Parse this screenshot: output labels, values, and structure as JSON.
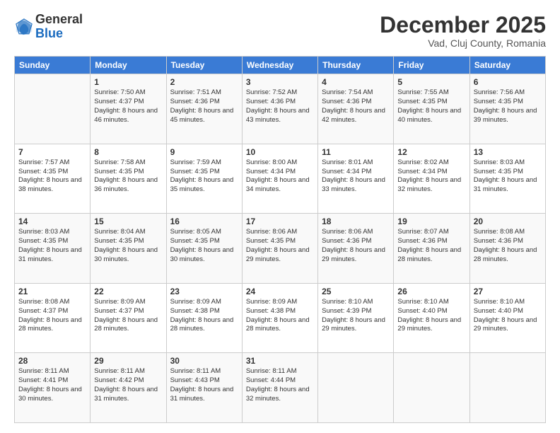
{
  "header": {
    "logo_general": "General",
    "logo_blue": "Blue",
    "month_title": "December 2025",
    "subtitle": "Vad, Cluj County, Romania"
  },
  "days_of_week": [
    "Sunday",
    "Monday",
    "Tuesday",
    "Wednesday",
    "Thursday",
    "Friday",
    "Saturday"
  ],
  "weeks": [
    [
      {
        "day": "",
        "sunrise": "",
        "sunset": "",
        "daylight": ""
      },
      {
        "day": "1",
        "sunrise": "Sunrise: 7:50 AM",
        "sunset": "Sunset: 4:37 PM",
        "daylight": "Daylight: 8 hours and 46 minutes."
      },
      {
        "day": "2",
        "sunrise": "Sunrise: 7:51 AM",
        "sunset": "Sunset: 4:36 PM",
        "daylight": "Daylight: 8 hours and 45 minutes."
      },
      {
        "day": "3",
        "sunrise": "Sunrise: 7:52 AM",
        "sunset": "Sunset: 4:36 PM",
        "daylight": "Daylight: 8 hours and 43 minutes."
      },
      {
        "day": "4",
        "sunrise": "Sunrise: 7:54 AM",
        "sunset": "Sunset: 4:36 PM",
        "daylight": "Daylight: 8 hours and 42 minutes."
      },
      {
        "day": "5",
        "sunrise": "Sunrise: 7:55 AM",
        "sunset": "Sunset: 4:35 PM",
        "daylight": "Daylight: 8 hours and 40 minutes."
      },
      {
        "day": "6",
        "sunrise": "Sunrise: 7:56 AM",
        "sunset": "Sunset: 4:35 PM",
        "daylight": "Daylight: 8 hours and 39 minutes."
      }
    ],
    [
      {
        "day": "7",
        "sunrise": "Sunrise: 7:57 AM",
        "sunset": "Sunset: 4:35 PM",
        "daylight": "Daylight: 8 hours and 38 minutes."
      },
      {
        "day": "8",
        "sunrise": "Sunrise: 7:58 AM",
        "sunset": "Sunset: 4:35 PM",
        "daylight": "Daylight: 8 hours and 36 minutes."
      },
      {
        "day": "9",
        "sunrise": "Sunrise: 7:59 AM",
        "sunset": "Sunset: 4:35 PM",
        "daylight": "Daylight: 8 hours and 35 minutes."
      },
      {
        "day": "10",
        "sunrise": "Sunrise: 8:00 AM",
        "sunset": "Sunset: 4:34 PM",
        "daylight": "Daylight: 8 hours and 34 minutes."
      },
      {
        "day": "11",
        "sunrise": "Sunrise: 8:01 AM",
        "sunset": "Sunset: 4:34 PM",
        "daylight": "Daylight: 8 hours and 33 minutes."
      },
      {
        "day": "12",
        "sunrise": "Sunrise: 8:02 AM",
        "sunset": "Sunset: 4:34 PM",
        "daylight": "Daylight: 8 hours and 32 minutes."
      },
      {
        "day": "13",
        "sunrise": "Sunrise: 8:03 AM",
        "sunset": "Sunset: 4:35 PM",
        "daylight": "Daylight: 8 hours and 31 minutes."
      }
    ],
    [
      {
        "day": "14",
        "sunrise": "Sunrise: 8:03 AM",
        "sunset": "Sunset: 4:35 PM",
        "daylight": "Daylight: 8 hours and 31 minutes."
      },
      {
        "day": "15",
        "sunrise": "Sunrise: 8:04 AM",
        "sunset": "Sunset: 4:35 PM",
        "daylight": "Daylight: 8 hours and 30 minutes."
      },
      {
        "day": "16",
        "sunrise": "Sunrise: 8:05 AM",
        "sunset": "Sunset: 4:35 PM",
        "daylight": "Daylight: 8 hours and 30 minutes."
      },
      {
        "day": "17",
        "sunrise": "Sunrise: 8:06 AM",
        "sunset": "Sunset: 4:35 PM",
        "daylight": "Daylight: 8 hours and 29 minutes."
      },
      {
        "day": "18",
        "sunrise": "Sunrise: 8:06 AM",
        "sunset": "Sunset: 4:36 PM",
        "daylight": "Daylight: 8 hours and 29 minutes."
      },
      {
        "day": "19",
        "sunrise": "Sunrise: 8:07 AM",
        "sunset": "Sunset: 4:36 PM",
        "daylight": "Daylight: 8 hours and 28 minutes."
      },
      {
        "day": "20",
        "sunrise": "Sunrise: 8:08 AM",
        "sunset": "Sunset: 4:36 PM",
        "daylight": "Daylight: 8 hours and 28 minutes."
      }
    ],
    [
      {
        "day": "21",
        "sunrise": "Sunrise: 8:08 AM",
        "sunset": "Sunset: 4:37 PM",
        "daylight": "Daylight: 8 hours and 28 minutes."
      },
      {
        "day": "22",
        "sunrise": "Sunrise: 8:09 AM",
        "sunset": "Sunset: 4:37 PM",
        "daylight": "Daylight: 8 hours and 28 minutes."
      },
      {
        "day": "23",
        "sunrise": "Sunrise: 8:09 AM",
        "sunset": "Sunset: 4:38 PM",
        "daylight": "Daylight: 8 hours and 28 minutes."
      },
      {
        "day": "24",
        "sunrise": "Sunrise: 8:09 AM",
        "sunset": "Sunset: 4:38 PM",
        "daylight": "Daylight: 8 hours and 28 minutes."
      },
      {
        "day": "25",
        "sunrise": "Sunrise: 8:10 AM",
        "sunset": "Sunset: 4:39 PM",
        "daylight": "Daylight: 8 hours and 29 minutes."
      },
      {
        "day": "26",
        "sunrise": "Sunrise: 8:10 AM",
        "sunset": "Sunset: 4:40 PM",
        "daylight": "Daylight: 8 hours and 29 minutes."
      },
      {
        "day": "27",
        "sunrise": "Sunrise: 8:10 AM",
        "sunset": "Sunset: 4:40 PM",
        "daylight": "Daylight: 8 hours and 29 minutes."
      }
    ],
    [
      {
        "day": "28",
        "sunrise": "Sunrise: 8:11 AM",
        "sunset": "Sunset: 4:41 PM",
        "daylight": "Daylight: 8 hours and 30 minutes."
      },
      {
        "day": "29",
        "sunrise": "Sunrise: 8:11 AM",
        "sunset": "Sunset: 4:42 PM",
        "daylight": "Daylight: 8 hours and 31 minutes."
      },
      {
        "day": "30",
        "sunrise": "Sunrise: 8:11 AM",
        "sunset": "Sunset: 4:43 PM",
        "daylight": "Daylight: 8 hours and 31 minutes."
      },
      {
        "day": "31",
        "sunrise": "Sunrise: 8:11 AM",
        "sunset": "Sunset: 4:44 PM",
        "daylight": "Daylight: 8 hours and 32 minutes."
      },
      {
        "day": "",
        "sunrise": "",
        "sunset": "",
        "daylight": ""
      },
      {
        "day": "",
        "sunrise": "",
        "sunset": "",
        "daylight": ""
      },
      {
        "day": "",
        "sunrise": "",
        "sunset": "",
        "daylight": ""
      }
    ]
  ]
}
